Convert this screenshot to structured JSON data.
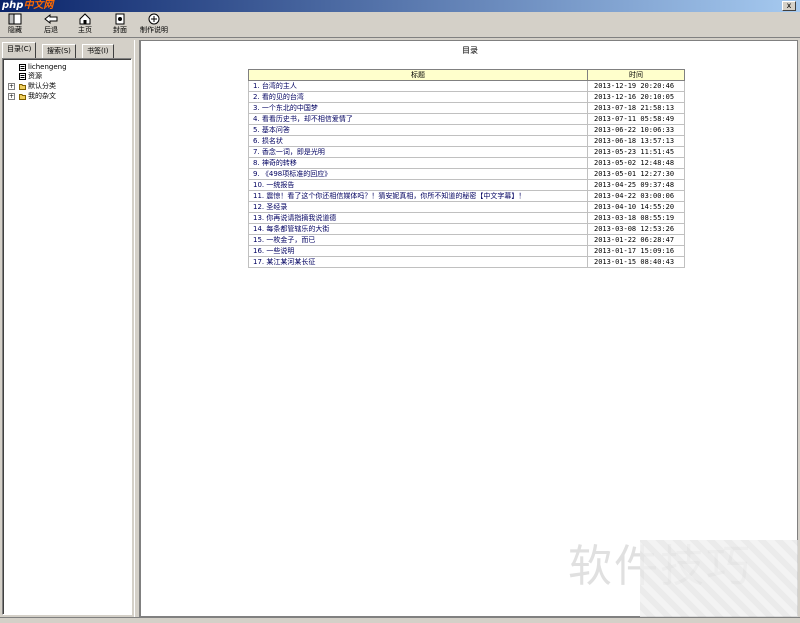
{
  "titlebar": {
    "logo_php": "php",
    "logo_cn": "中文网",
    "close": "x"
  },
  "toolbar": {
    "items": [
      {
        "label": "隐藏",
        "icon": "hide-icon"
      },
      {
        "label": "后退",
        "icon": "back-icon"
      },
      {
        "label": "主页",
        "icon": "home-icon"
      },
      {
        "label": "封面",
        "icon": "cover-icon"
      },
      {
        "label": "制作说明",
        "icon": "info-icon"
      }
    ]
  },
  "left": {
    "tabs": [
      "目录(C)",
      "搜索(S)",
      "书签(I)"
    ],
    "tree": [
      {
        "label": "lichengeng",
        "icon": "page-icon"
      },
      {
        "label": "资源",
        "icon": "page-icon"
      },
      {
        "label": "默认分类",
        "icon": "folder-icon",
        "expander": "+"
      },
      {
        "label": "我的杂文",
        "icon": "folder-icon",
        "expander": "+"
      }
    ]
  },
  "content": {
    "title": "目录",
    "headers": {
      "title": "标题",
      "time": "时间"
    },
    "rows": [
      {
        "title": "1. 台湾的主人",
        "time": "2013-12-19 20:20:46"
      },
      {
        "title": "2. 看的见的台湾",
        "time": "2013-12-16 20:10:05"
      },
      {
        "title": "3. 一个东北的中国梦",
        "time": "2013-07-18 21:58:13"
      },
      {
        "title": "4. 看看历史书，却不相信爱情了",
        "time": "2013-07-11 05:58:49"
      },
      {
        "title": "5. 基本问答",
        "time": "2013-06-22 10:06:33"
      },
      {
        "title": "6. 损名状",
        "time": "2013-06-18 13:57:13"
      },
      {
        "title": "7. 香念一词，即是光明",
        "time": "2013-05-23 11:51:45"
      },
      {
        "title": "8. 神奇的转移",
        "time": "2013-05-02 12:48:48"
      },
      {
        "title": "9. 《498项标准的回应》",
        "time": "2013-05-01 12:27:30"
      },
      {
        "title": "10. 一统报告",
        "time": "2013-04-25 09:37:48"
      },
      {
        "title": "11. 震惊！看了这个你还相信媒体吗？！猜安妮真相，你所不知道的秘密【中文字幕】！",
        "time": "2013-04-22 03:00:06"
      },
      {
        "title": "12. 圣经录",
        "time": "2013-04-10 14:55:20"
      },
      {
        "title": "13. 你再说请指摘我说道德",
        "time": "2013-03-18 08:55:19"
      },
      {
        "title": "14. 每条都管辖乐的大街",
        "time": "2013-03-08 12:53:26"
      },
      {
        "title": "15. 一枚金子，而已",
        "time": "2013-01-22 06:28:47"
      },
      {
        "title": "16. 一些说明",
        "time": "2013-01-17 15:09:16"
      },
      {
        "title": "17. 某江某河某长征",
        "time": "2013-01-15 08:40:43"
      }
    ]
  },
  "watermark": "软件技巧"
}
